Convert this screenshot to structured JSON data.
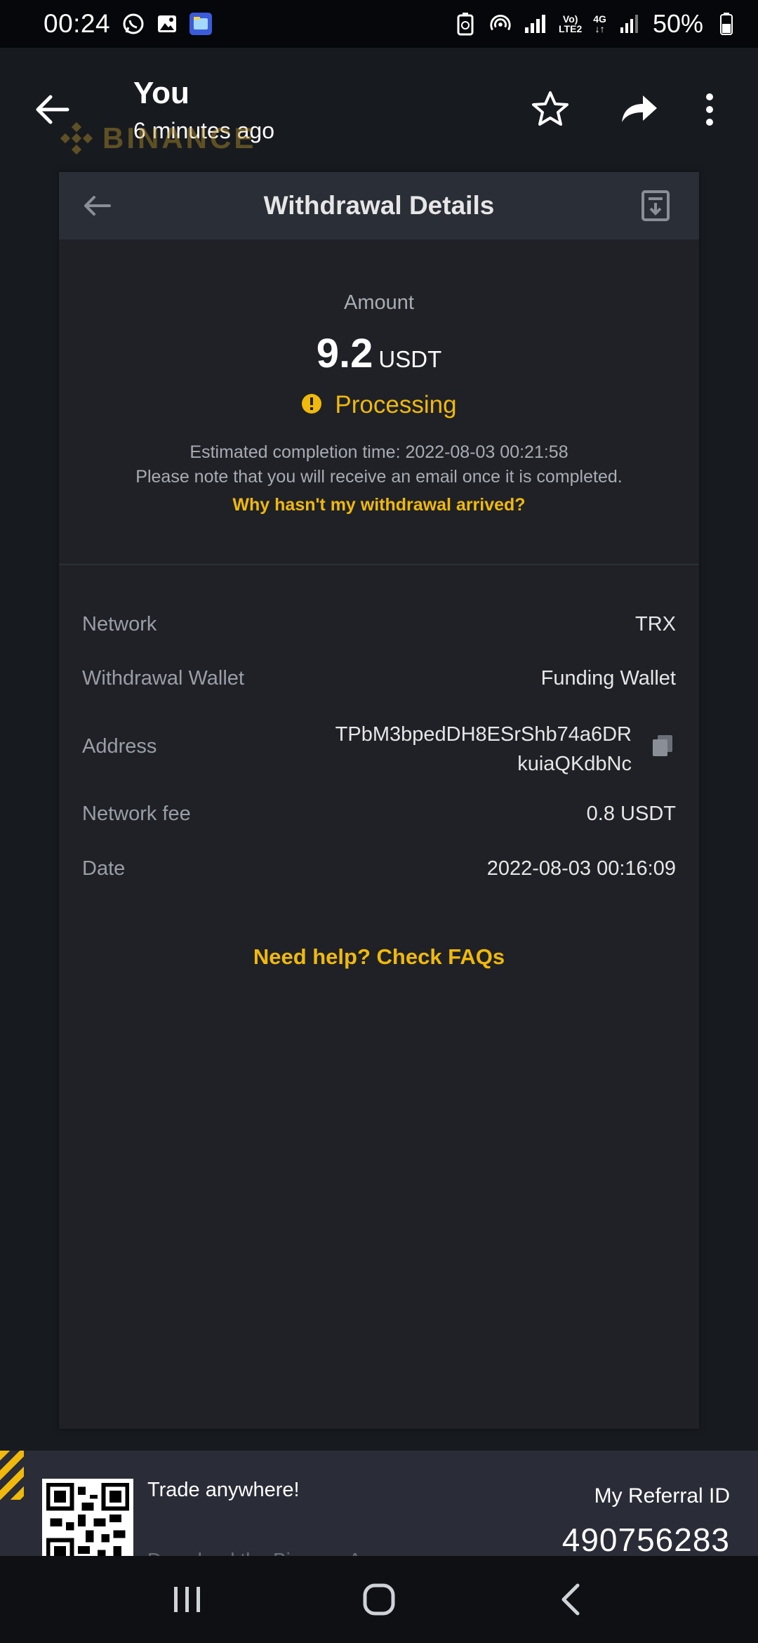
{
  "status_bar": {
    "time": "00:24",
    "battery": "50%",
    "net_type_1": "Vo)",
    "net_type_2": "LTE2",
    "net_gen": "4G"
  },
  "viewer": {
    "sender": "You",
    "sent_time": "6 minutes ago"
  },
  "watermark": {
    "logo_text": "BINANCE"
  },
  "card": {
    "title": "Withdrawal Details",
    "amount_label": "Amount",
    "amount_value": "9.2",
    "amount_unit": "USDT",
    "status": "Processing",
    "estimated": "Estimated completion time: 2022-08-03 00:21:58",
    "note": "Please note that you will receive an email once it is completed.",
    "why_link": "Why hasn't my withdrawal arrived?",
    "rows": {
      "network_label": "Network",
      "network_value": "TRX",
      "wallet_label": "Withdrawal Wallet",
      "wallet_value": "Funding Wallet",
      "address_label": "Address",
      "address_line1": "TPbM3bpedDH8ESrShb74a6DR",
      "address_line2": "kuiaQKdbNc",
      "fee_label": "Network fee",
      "fee_value": "0.8 USDT",
      "date_label": "Date",
      "date_value": "2022-08-03 00:16:09"
    },
    "faq_link": "Need help? Check FAQs"
  },
  "footer": {
    "trade_text": "Trade anywhere!",
    "download_text": "Download the Binance App",
    "ref_label": "My Referral ID",
    "ref_id": "490756283"
  },
  "colors": {
    "accent": "#f0b90b",
    "background": "#171b20",
    "card": "#1f2126"
  }
}
